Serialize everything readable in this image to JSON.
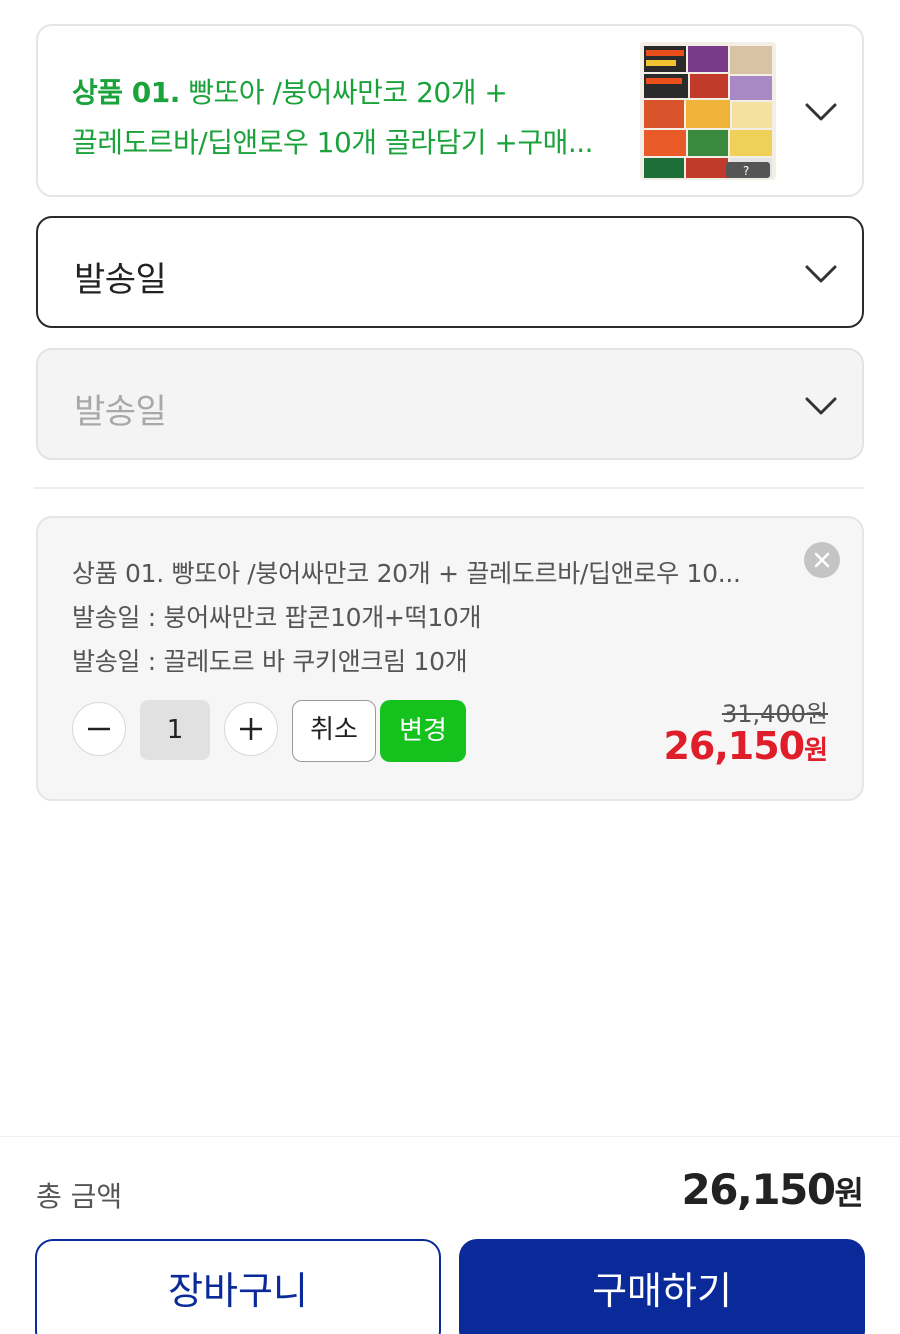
{
  "product_selector": {
    "prefix": "상품 01.",
    "line1": " 빵또아 /붕어싸만코 20개 +",
    "line2": "끌레도르바/딥앤로우 10개 골라담기 +구매...",
    "thumbnail_icon": "ice-cream-assortment-image",
    "title_color": "#1aa33a"
  },
  "option_dropdowns": [
    {
      "label": "발송일",
      "state": "active"
    },
    {
      "label": "발송일",
      "state": "disabled"
    }
  ],
  "selected_item": {
    "line1": "상품 01. 빵또아 /붕어싸만코 20개 + 끌레도르바/딥앤로우 10...",
    "line2": "발송일 : 붕어싸만코 팝콘10개+떡10개",
    "line3": "발송일 : 끌레도르 바 쿠키앤크림 10개",
    "quantity": "1",
    "cancel_label": "취소",
    "change_label": "변경",
    "original_price": "31,400원",
    "sale_price_number": "26,150",
    "sale_price_unit": "원",
    "change_color": "#15c21d",
    "sale_color": "#e01e29"
  },
  "footer": {
    "total_label": "총 금액",
    "total_number": "26,150",
    "total_unit": "원",
    "cart_label": "장바구니",
    "buy_label": "구매하기",
    "brand_color": "#0b2a9a"
  }
}
